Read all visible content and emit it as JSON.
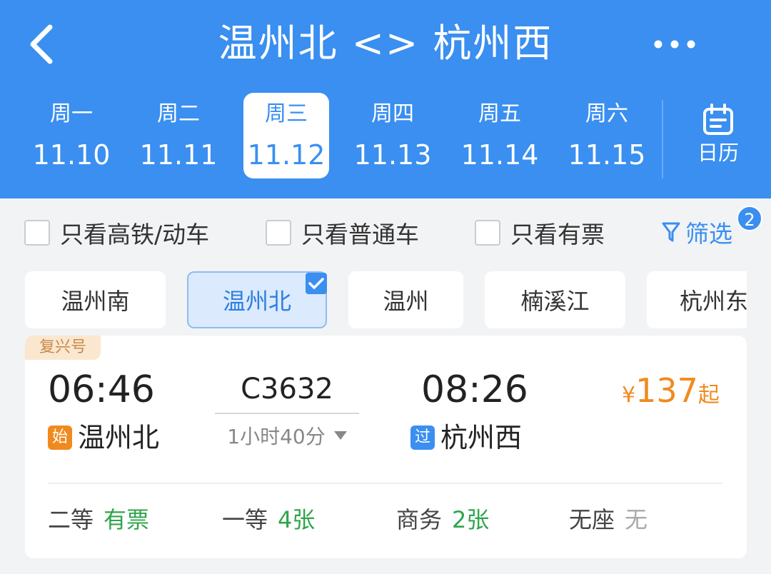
{
  "header": {
    "title": "温州北 <> 杭州西",
    "back_icon": "chevron-left-icon",
    "more_icon": "more-dots-icon"
  },
  "date_tabs": [
    {
      "weekday": "周一",
      "date": "11.10",
      "selected": false
    },
    {
      "weekday": "周二",
      "date": "11.11",
      "selected": false
    },
    {
      "weekday": "周三",
      "date": "11.12",
      "selected": true
    },
    {
      "weekday": "周四",
      "date": "11.13",
      "selected": false
    },
    {
      "weekday": "周五",
      "date": "11.14",
      "selected": false
    },
    {
      "weekday": "周六",
      "date": "11.15",
      "selected": false
    }
  ],
  "calendar": {
    "label": "日历",
    "icon": "calendar-icon"
  },
  "filters": {
    "options": [
      {
        "label": "只看高铁/动车",
        "checked": false
      },
      {
        "label": "只看普通车",
        "checked": false
      },
      {
        "label": "只看有票",
        "checked": false
      }
    ],
    "filter_label": "筛选",
    "filter_count": "2"
  },
  "stations": [
    {
      "name": "温州南",
      "selected": false
    },
    {
      "name": "温州北",
      "selected": true
    },
    {
      "name": "温州",
      "selected": false
    },
    {
      "name": "楠溪江",
      "selected": false
    },
    {
      "name": "杭州东",
      "selected": false
    }
  ],
  "train": {
    "tag": "复兴号",
    "depart_time": "06:46",
    "arrive_time": "08:26",
    "train_no": "C3632",
    "duration": "1小时40分",
    "from_station": "温州北",
    "from_marker": "始",
    "to_station": "杭州西",
    "to_marker": "过",
    "price_currency": "¥",
    "price_value": "137",
    "price_suffix": "起",
    "seats": [
      {
        "class": "二等",
        "status": "有票"
      },
      {
        "class": "一等",
        "status": "4张"
      },
      {
        "class": "商务",
        "status": "2张"
      },
      {
        "class": "无座",
        "status": "无"
      }
    ]
  },
  "colors": {
    "brand_blue": "#3a8ff0",
    "price_orange": "#f08a1e",
    "available_green": "#2fa54c",
    "start_marker": "#f08a1e",
    "pass_marker": "#3a8ff0"
  }
}
